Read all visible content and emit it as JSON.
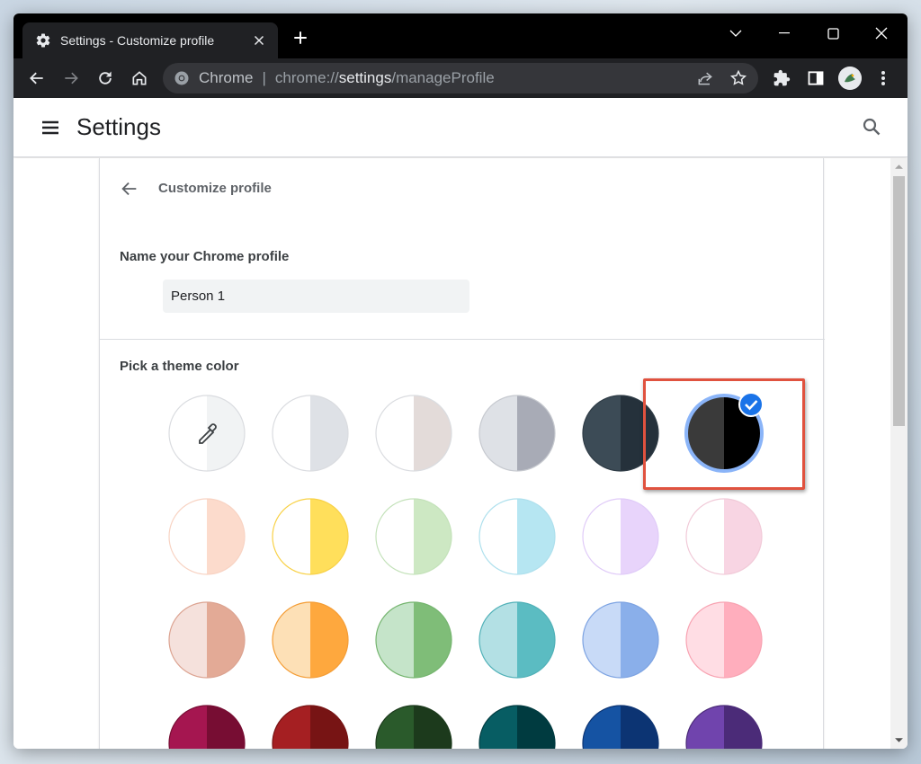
{
  "tab": {
    "title": "Settings - Customize profile"
  },
  "omnibox": {
    "site": "Chrome",
    "url_scheme": "chrome://",
    "url_host": "settings",
    "url_path": "/manageProfile"
  },
  "header": {
    "title": "Settings"
  },
  "subpage": {
    "title": "Customize profile",
    "name_label": "Name your Chrome profile",
    "name_value": "Person 1",
    "theme_label": "Pick a theme color"
  },
  "theme_colors": [
    {
      "name": "custom-color",
      "left": "#ffffff",
      "right": "#f1f3f4",
      "border": "#dadce0"
    },
    {
      "name": "default-light",
      "left": "#ffffff",
      "right": "#dee1e6",
      "border": "#dadce0"
    },
    {
      "name": "warm-grey",
      "left": "#ffffff",
      "right": "#e3dbd9",
      "border": "#dadce0"
    },
    {
      "name": "cool-grey",
      "left": "#dee1e6",
      "right": "#a8abb6",
      "border": "#c6c9cf"
    },
    {
      "name": "dark-slate",
      "left": "#3c4b56",
      "right": "#25313b",
      "border": "#2f3c46"
    },
    {
      "name": "black",
      "left": "#3a3a3a",
      "right": "#000000",
      "border": "#8ab4f8",
      "selected": true
    },
    {
      "name": "peach",
      "left": "#ffffff",
      "right": "#fcdbcc",
      "border": "#f8d3c3"
    },
    {
      "name": "yellow",
      "left": "#ffffff",
      "right": "#ffdf5b",
      "border": "#f8d146"
    },
    {
      "name": "mint",
      "left": "#ffffff",
      "right": "#cde8c3",
      "border": "#c4e2ba"
    },
    {
      "name": "light-aqua",
      "left": "#ffffff",
      "right": "#b6e6f2",
      "border": "#aee0ed"
    },
    {
      "name": "lavender",
      "left": "#ffffff",
      "right": "#e8d4fb",
      "border": "#e0cbf8"
    },
    {
      "name": "pink",
      "left": "#ffffff",
      "right": "#f8d5e3",
      "border": "#f1cad8"
    },
    {
      "name": "terracotta",
      "left": "#f5e1dc",
      "right": "#e3aa96",
      "border": "#dca391"
    },
    {
      "name": "orange",
      "left": "#fde0b6",
      "right": "#fea83e",
      "border": "#f49d36"
    },
    {
      "name": "green",
      "left": "#c5e4c9",
      "right": "#7fbd78",
      "border": "#75b56f"
    },
    {
      "name": "aqua",
      "left": "#b3e0e4",
      "right": "#5bbcc2",
      "border": "#51b1b8"
    },
    {
      "name": "blue",
      "left": "#c8daf7",
      "right": "#8aafea",
      "border": "#7da3e2"
    },
    {
      "name": "rose",
      "left": "#ffdde4",
      "right": "#ffaebd",
      "border": "#f8a3b2"
    },
    {
      "name": "magenta",
      "left": "#a51650",
      "right": "#770d33",
      "border": "#770d33"
    },
    {
      "name": "crimson",
      "left": "#a51f22",
      "right": "#771414",
      "border": "#771414"
    },
    {
      "name": "forest",
      "left": "#2a5a2b",
      "right": "#1c3a1c",
      "border": "#1c3a1c"
    },
    {
      "name": "teal",
      "left": "#075d63",
      "right": "#003b40",
      "border": "#003b40"
    },
    {
      "name": "navy",
      "left": "#1553a3",
      "right": "#0c3473",
      "border": "#0c3473"
    },
    {
      "name": "purple",
      "left": "#7044ad",
      "right": "#4b2b78",
      "border": "#4b2b78"
    }
  ]
}
